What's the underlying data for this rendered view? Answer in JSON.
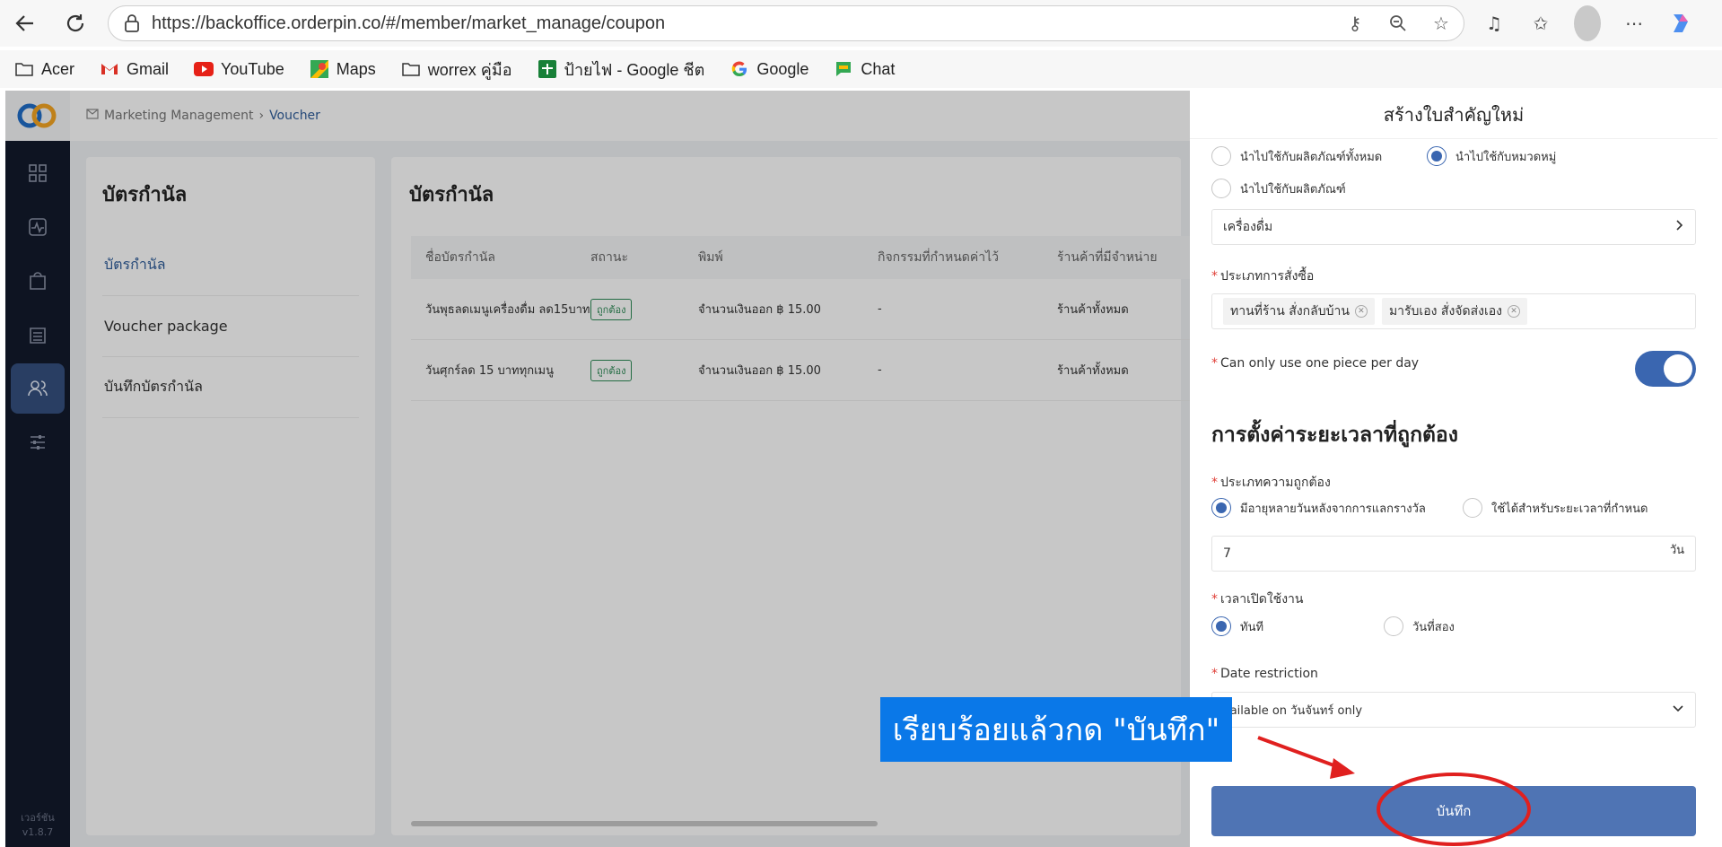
{
  "browser": {
    "url": "https://backoffice.orderpin.co/#/member/market_manage/coupon",
    "bookmarks": [
      {
        "label": "Acer",
        "icon": "folder-icon"
      },
      {
        "label": "Gmail",
        "icon": "gmail-icon"
      },
      {
        "label": "YouTube",
        "icon": "youtube-icon"
      },
      {
        "label": "Maps",
        "icon": "maps-icon"
      },
      {
        "label": "worrex คู่มือ",
        "icon": "folder-icon"
      },
      {
        "label": "ป้ายไฟ - Google ชีต",
        "icon": "sheets-icon"
      },
      {
        "label": "Google",
        "icon": "google-icon"
      },
      {
        "label": "Chat",
        "icon": "chat-icon"
      }
    ]
  },
  "app": {
    "breadcrumb": {
      "first": "Marketing Management",
      "second": "Voucher"
    },
    "version_label": "เวอร์ชัน",
    "version": "v1.8.7"
  },
  "left_panel": {
    "title": "บัตรกำนัล",
    "menu": [
      "บัตรกำนัล",
      "Voucher package",
      "บันทึกบัตรกำนัล"
    ]
  },
  "main": {
    "title": "บัตรกำนัล",
    "columns": [
      "ชื่อบัตรกำนัล",
      "สถานะ",
      "พิมพ์",
      "กิจกรรมที่กำหนดค่าไว้",
      "ร้านค้าที่มีจำหน่าย"
    ],
    "rows": [
      {
        "name": "วันพุธลดเมนูเครื่องดื่ม ลด15บาท",
        "status": "ถูกต้อง",
        "type": "จำนวนเงินออก ฿ 15.00",
        "activity": "-",
        "stores": "ร้านค้าทั้งหมด"
      },
      {
        "name": "วันศุกร์ลด 15 บาททุกเมนู",
        "status": "ถูกต้อง",
        "type": "จำนวนเงินออก ฿ 15.00",
        "activity": "-",
        "stores": "ร้านค้าทั้งหมด"
      }
    ]
  },
  "drawer": {
    "title": "สร้างใบสำคัญใหม่",
    "apply_all": "นำไปใช้กับผลิตภัณฑ์ทั้งหมด",
    "apply_category": "นำไปใช้กับหมวดหมู่",
    "apply_product": "นำไปใช้กับผลิตภัณฑ์",
    "category_value": "เครื่องดื่ม",
    "order_type_label": "ประเภทการสั่งซื้อ",
    "order_chips": [
      "ทานที่ร้าน สั่งกลับบ้าน",
      "มารับเอง สั่งจัดส่งเอง"
    ],
    "one_per_day_label": "Can only use one piece per day",
    "one_per_day_on": true,
    "validity_section": "การตั้งค่าระยะเวลาที่ถูกต้อง",
    "validity_type_label": "ประเภทความถูกต้อง",
    "validity_opt1": "มีอายุหลายวันหลังจากการแลกรางวัล",
    "validity_opt2": "ใช้ได้สำหรับระยะเวลาที่กำหนด",
    "days_value": "7",
    "days_unit": "วัน",
    "start_label": "เวลาเปิดใช้งาน",
    "start_opt1": "ทันที",
    "start_opt2": "วันที่สอง",
    "date_restriction_label": "Date restriction",
    "date_restriction_value": "vailable on วันจันทร์ only",
    "save_label": "บันทึก"
  },
  "annotation": {
    "text": "เรียบร้อยแล้วกด \"บันทึก\"",
    "color": "#0a78e8",
    "mark_color": "#e0201f"
  }
}
